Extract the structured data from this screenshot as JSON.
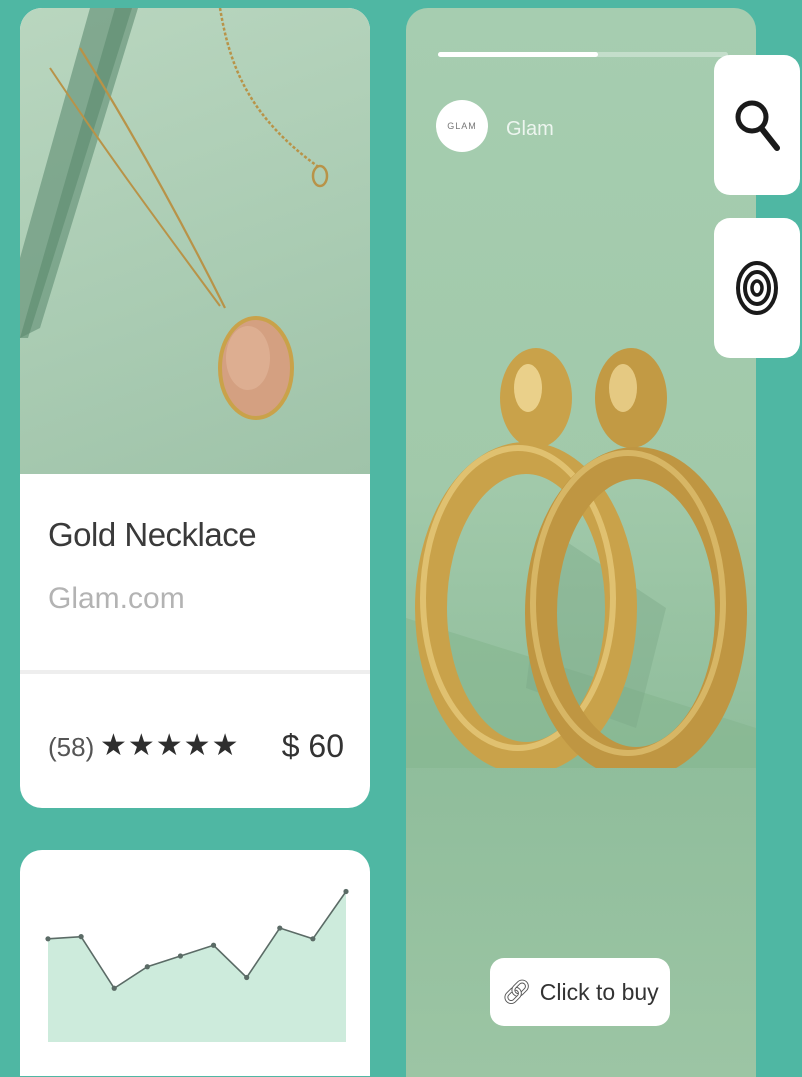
{
  "product": {
    "title": "Gold Necklace",
    "seller": "Glam.com",
    "rating_count": "(58)",
    "stars": "★★★★★",
    "rating": 5,
    "price": "$ 60"
  },
  "story": {
    "brand_name": "Glam",
    "avatar_text": "GLAM",
    "progress": 0.55,
    "cta_label": "Click to buy",
    "cta_icon": "link-icon"
  },
  "side_actions": [
    {
      "name": "search",
      "icon": "search-icon"
    },
    {
      "name": "target",
      "icon": "target-icon"
    }
  ],
  "colors": {
    "background": "#4fb7a3",
    "card": "#ffffff",
    "chart_fill": "#cdebdc",
    "chart_line": "#5b6b66",
    "gold": "#c9a24a"
  },
  "chart_data": {
    "type": "area",
    "x": [
      1,
      2,
      3,
      4,
      5,
      6,
      7,
      8,
      9,
      10
    ],
    "values": [
      48,
      49,
      25,
      35,
      40,
      45,
      30,
      53,
      48,
      70
    ],
    "ylim": [
      0,
      80
    ],
    "title": "",
    "xlabel": "",
    "ylabel": "",
    "grid": false
  }
}
